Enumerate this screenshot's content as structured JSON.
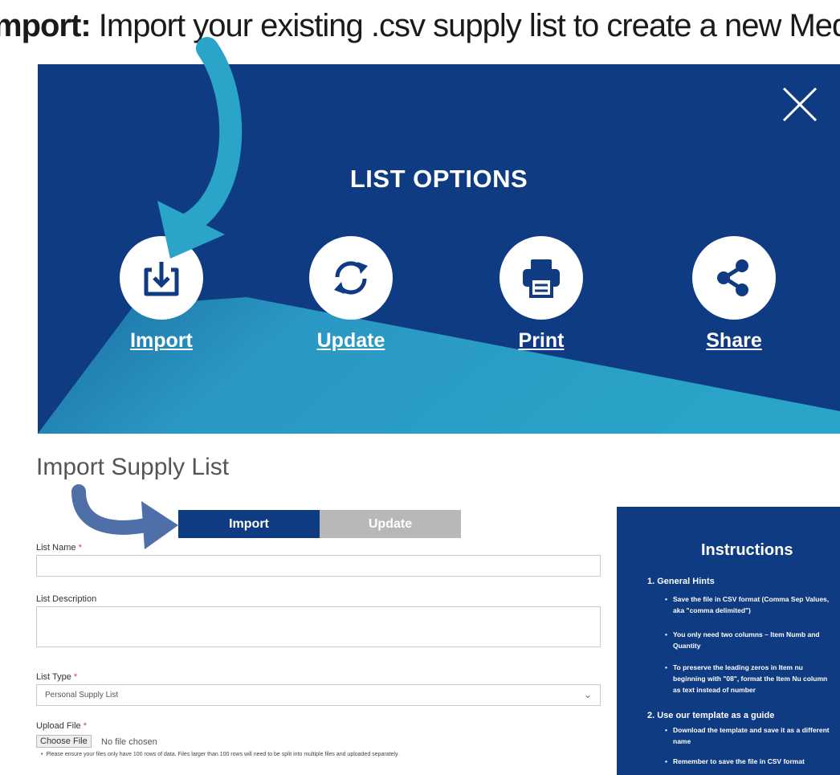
{
  "caption": {
    "bold": "mport:",
    "text": " Import your existing .csv supply list to create a new Medc"
  },
  "modal": {
    "title": "LIST OPTIONS",
    "options": [
      {
        "label": "Import",
        "icon": "import-icon"
      },
      {
        "label": "Update",
        "icon": "refresh-icon"
      },
      {
        "label": "Print",
        "icon": "printer-icon"
      },
      {
        "label": "Share",
        "icon": "share-icon"
      }
    ],
    "close_icon": "close-icon"
  },
  "form": {
    "title": "Import Supply List",
    "tabs": {
      "import": "Import",
      "update": "Update"
    },
    "list_name_label": "List Name",
    "list_description_label": "List Description",
    "list_type_label": "List Type",
    "list_type_value": "Personal Supply List",
    "upload_label": "Upload File",
    "choose_file": "Choose File",
    "file_status": "No file chosen",
    "required_mark": "*",
    "note": "Please ensure your files only have 100 rows of data. Files larger than 100 rows will need to be split into multiple files and uploaded separately."
  },
  "instructions": {
    "title": "Instructions",
    "section1": "1. General Hints",
    "hints1": [
      "Save the file in CSV format (Comma Sep Values, aka \"comma delimited\")",
      "You only need two columns – Item Numb and Quantity",
      "To preserve the leading zeros in Item nu beginning with \"08\", format the Item Nu column as text instead of number"
    ],
    "section2": "2. Use our template as a guide",
    "hints2": [
      "Download the template and save it as a different name",
      "Remember to save the file in CSV format"
    ]
  },
  "colors": {
    "modal_blue": "#0f3b82",
    "accent_teal": "#2aa4c8",
    "tab_inactive": "#b8b8b8",
    "pointer_arrow": "#4e6fa8"
  }
}
